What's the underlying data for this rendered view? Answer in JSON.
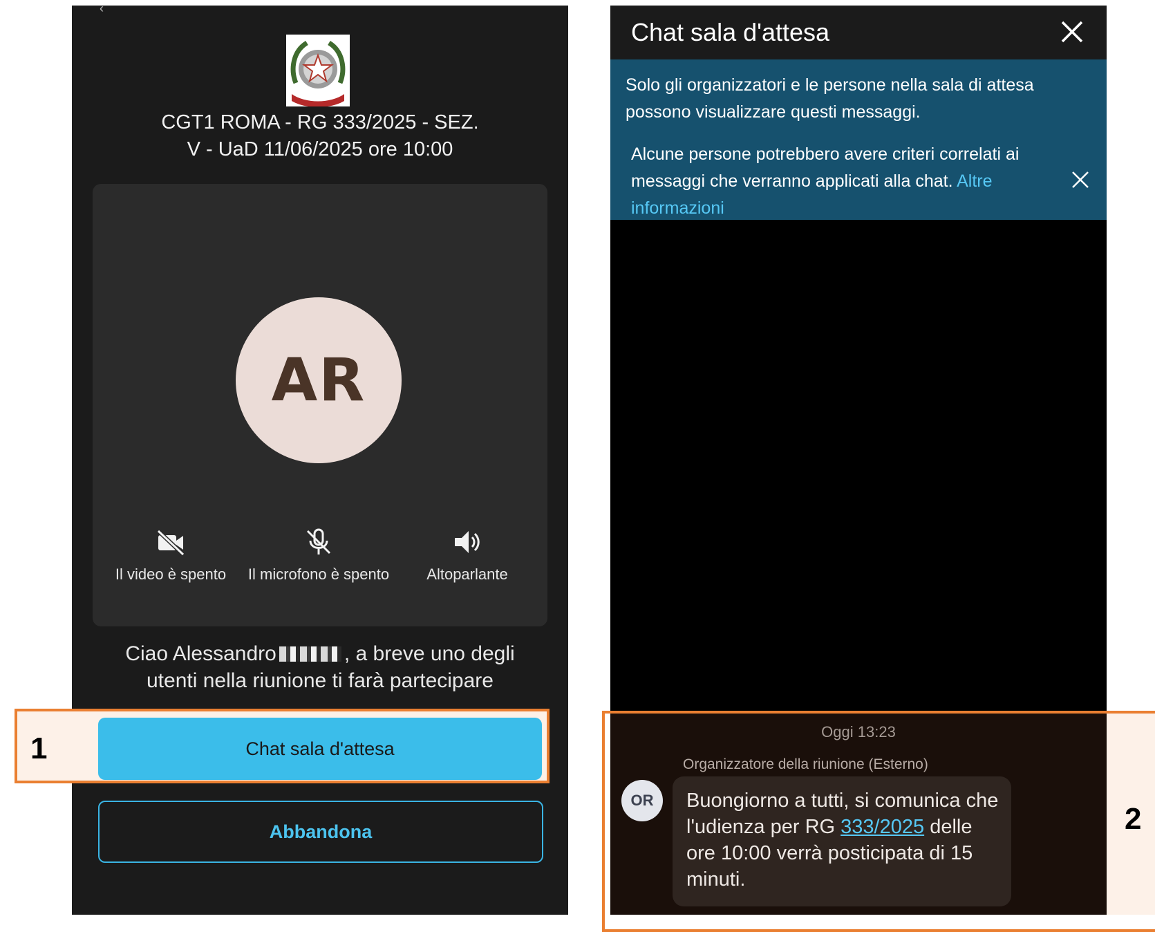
{
  "left_screen": {
    "meeting_title_line1": "CGT1 ROMA - RG 333/2025 - SEZ.",
    "meeting_title_line2": "V - UaD 11/06/2025 ore 10:00",
    "avatar_initials": "AR",
    "controls": {
      "video_label": "Il video è spento",
      "mic_label": "Il microfono è spento",
      "speaker_label": "Altoparlante"
    },
    "greeting_part1": "Ciao Alessandro",
    "greeting_part2": ", a breve uno degli",
    "greeting_line2": "utenti nella riunione ti farà partecipare",
    "chat_button_label": "Chat sala d'attesa",
    "leave_button_label": "Abbandona"
  },
  "right_screen": {
    "header_title": "Chat sala d'attesa",
    "info_text1": "Solo gli organizzatori e le persone nella sala di attesa possono visualizzare questi messaggi.",
    "info_text2": "Alcune persone potrebbero avere criteri correlati ai messaggi che verranno applicati alla chat.",
    "info_link": "Altre informazioni",
    "message": {
      "timestamp": "Oggi 13:23",
      "sender": "Organizzatore della riunione (Esterno)",
      "avatar_initials": "OR",
      "text_before_link": "Buongiorno a tutti, si comunica che l'udienza per RG",
      "link_text": "333/2025",
      "text_after_link": "delle ore 10:00 verrà posticipata di 15 minuti."
    }
  },
  "annotations": {
    "label_1": "1",
    "label_2": "2"
  },
  "colors": {
    "accent_blue": "#3bbdea",
    "banner_blue": "#16516e",
    "link_blue": "#56c8f5",
    "annotation_orange": "#ea7f31"
  }
}
